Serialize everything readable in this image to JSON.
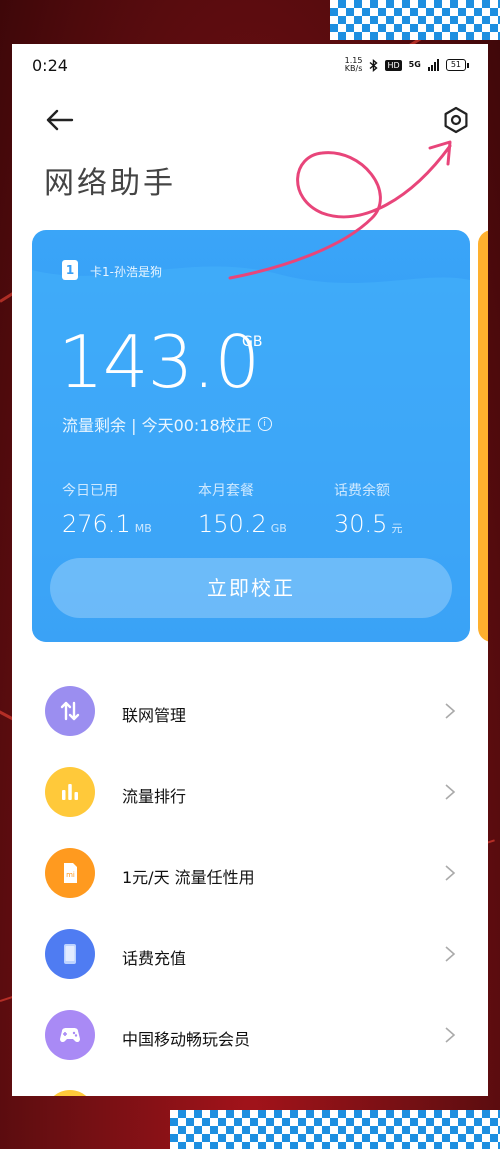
{
  "status_bar": {
    "time": "0:24",
    "speed_value": "1.15",
    "speed_unit": "KB/s",
    "hd": "HD",
    "network": "5G",
    "battery": "51"
  },
  "header": {
    "title": "网络助手"
  },
  "card": {
    "sim_number": "1",
    "sim_label": "卡1-孙浩是狗",
    "remaining_value": "143.0",
    "remaining_unit": "GB",
    "remaining_caption": "流量剩余 | 今天00:18校正",
    "stats": [
      {
        "label": "今日已用",
        "value": "276.1",
        "unit": "MB"
      },
      {
        "label": "本月套餐",
        "value": "150.2",
        "unit": "GB"
      },
      {
        "label": "话费余额",
        "value": "30.5",
        "unit": "元"
      }
    ],
    "calibrate_button": "立即校正"
  },
  "menu": {
    "items": [
      {
        "label": "联网管理",
        "icon": "arrows-updown-icon",
        "color": "#9b8ef0"
      },
      {
        "label": "流量排行",
        "icon": "bar-chart-icon",
        "color": "#ffc93a"
      },
      {
        "label": "1元/天 流量任性用",
        "icon": "mi-sim-icon",
        "color": "#ff9a1f"
      },
      {
        "label": "话费充值",
        "icon": "phone-card-icon",
        "color": "#4f7cf2"
      },
      {
        "label": "中国移动畅玩会员",
        "icon": "gamepad-icon",
        "color": "#a98af5"
      }
    ]
  },
  "colors": {
    "card_top": "#3aa5f8",
    "card_bottom": "#2e8ff0",
    "accent_next_card": "#ffb02e",
    "scribble": "#e8457a"
  }
}
